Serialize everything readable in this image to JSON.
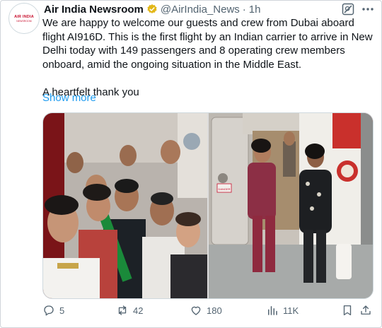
{
  "author": {
    "avatar_line1": "AIR INDIA",
    "avatar_line2": "NEWSROOM",
    "name": "Air India Newsroom",
    "handle": "@AirIndia_News",
    "separator": "·",
    "time": "1h"
  },
  "tweet": {
    "text": "We are happy to welcome our guests and crew from Dubai aboard flight AI916D. This is the first flight by an Indian carrier to arrive in New Delhi today with 149 passengers and 8 operating crew members onboard, amid the ongoing situation in the Middle East.\n\nA heartfelt thank you",
    "show_more": "Show more"
  },
  "media": {
    "left_photo": "crew-and-passengers-selfie",
    "right_photo": "passengers-deplaning",
    "door_placard": "DANGER"
  },
  "actions": {
    "replies": "5",
    "reposts": "42",
    "likes": "180",
    "views": "11K"
  },
  "colors": {
    "link": "#1d9bf0",
    "secondary_text": "#536471",
    "verified_gold": "#e2b719",
    "brand_red": "#c8102e"
  }
}
